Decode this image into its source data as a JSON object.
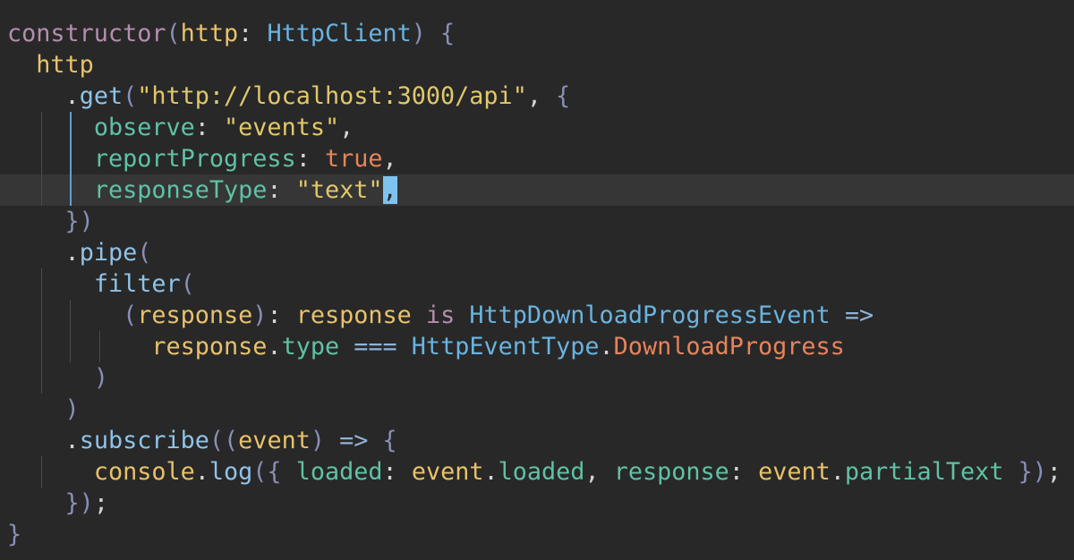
{
  "editor": {
    "theme": {
      "background": "#282828",
      "active_line": "#363636",
      "cursor": "#7ec3f0"
    },
    "cursor": {
      "line": 6,
      "token": ","
    },
    "lines": [
      {
        "tokens": [
          {
            "t": "constructor",
            "c": "kw"
          },
          {
            "t": "(",
            "c": "br"
          },
          {
            "t": "http",
            "c": "pm"
          },
          {
            "t": ": ",
            "c": "pu"
          },
          {
            "t": "HttpClient",
            "c": "ty"
          },
          {
            "t": ") {",
            "c": "br"
          }
        ]
      },
      {
        "tokens": [
          {
            "t": "  ",
            "c": "pu"
          },
          {
            "t": "http",
            "c": "id"
          }
        ]
      },
      {
        "tokens": [
          {
            "t": "    ",
            "c": "pu"
          },
          {
            "t": ".",
            "c": "pu"
          },
          {
            "t": "get",
            "c": "fn"
          },
          {
            "t": "(",
            "c": "br"
          },
          {
            "t": "\"http://localhost:3000/api\"",
            "c": "st"
          },
          {
            "t": ", ",
            "c": "pu"
          },
          {
            "t": "{",
            "c": "br"
          }
        ]
      },
      {
        "tokens": [
          {
            "t": "      ",
            "c": "pu"
          },
          {
            "t": "observe",
            "c": "pr"
          },
          {
            "t": ": ",
            "c": "pu"
          },
          {
            "t": "\"events\"",
            "c": "st"
          },
          {
            "t": ",",
            "c": "pu"
          }
        ]
      },
      {
        "tokens": [
          {
            "t": "      ",
            "c": "pu"
          },
          {
            "t": "reportProgress",
            "c": "pr"
          },
          {
            "t": ": ",
            "c": "pu"
          },
          {
            "t": "true",
            "c": "bo"
          },
          {
            "t": ",",
            "c": "pu"
          }
        ]
      },
      {
        "tokens": [
          {
            "t": "      ",
            "c": "pu"
          },
          {
            "t": "responseType",
            "c": "pr"
          },
          {
            "t": ": ",
            "c": "pu"
          },
          {
            "t": "\"text\"",
            "c": "st"
          },
          {
            "t": ",",
            "c": "cursor"
          }
        ]
      },
      {
        "tokens": [
          {
            "t": "    ",
            "c": "pu"
          },
          {
            "t": "})",
            "c": "br"
          }
        ]
      },
      {
        "tokens": [
          {
            "t": "    ",
            "c": "pu"
          },
          {
            "t": ".",
            "c": "pu"
          },
          {
            "t": "pipe",
            "c": "fn"
          },
          {
            "t": "(",
            "c": "br"
          }
        ]
      },
      {
        "tokens": [
          {
            "t": "      ",
            "c": "pu"
          },
          {
            "t": "filter",
            "c": "fn"
          },
          {
            "t": "(",
            "c": "br"
          }
        ]
      },
      {
        "tokens": [
          {
            "t": "        ",
            "c": "pu"
          },
          {
            "t": "(",
            "c": "br"
          },
          {
            "t": "response",
            "c": "pm"
          },
          {
            "t": ")",
            "c": "br"
          },
          {
            "t": ": ",
            "c": "pu"
          },
          {
            "t": "response",
            "c": "pm"
          },
          {
            "t": " ",
            "c": "pu"
          },
          {
            "t": "is",
            "c": "kw"
          },
          {
            "t": " ",
            "c": "pu"
          },
          {
            "t": "HttpDownloadProgressEvent",
            "c": "ty"
          },
          {
            "t": " ",
            "c": "pu"
          },
          {
            "t": "=>",
            "c": "op"
          }
        ]
      },
      {
        "tokens": [
          {
            "t": "          ",
            "c": "pu"
          },
          {
            "t": "response",
            "c": "pm"
          },
          {
            "t": ".",
            "c": "pu"
          },
          {
            "t": "type",
            "c": "pr"
          },
          {
            "t": " ",
            "c": "pu"
          },
          {
            "t": "===",
            "c": "op"
          },
          {
            "t": " ",
            "c": "pu"
          },
          {
            "t": "HttpEventType",
            "c": "ty"
          },
          {
            "t": ".",
            "c": "pu"
          },
          {
            "t": "DownloadProgress",
            "c": "bo"
          }
        ]
      },
      {
        "tokens": [
          {
            "t": "      ",
            "c": "pu"
          },
          {
            "t": ")",
            "c": "br"
          }
        ]
      },
      {
        "tokens": [
          {
            "t": "    ",
            "c": "pu"
          },
          {
            "t": ")",
            "c": "br"
          }
        ]
      },
      {
        "tokens": [
          {
            "t": "    ",
            "c": "pu"
          },
          {
            "t": ".",
            "c": "pu"
          },
          {
            "t": "subscribe",
            "c": "fn"
          },
          {
            "t": "((",
            "c": "br"
          },
          {
            "t": "event",
            "c": "pm"
          },
          {
            "t": ")",
            "c": "br"
          },
          {
            "t": " ",
            "c": "pu"
          },
          {
            "t": "=>",
            "c": "op"
          },
          {
            "t": " ",
            "c": "pu"
          },
          {
            "t": "{",
            "c": "br"
          }
        ]
      },
      {
        "tokens": [
          {
            "t": "      ",
            "c": "pu"
          },
          {
            "t": "console",
            "c": "id"
          },
          {
            "t": ".",
            "c": "pu"
          },
          {
            "t": "log",
            "c": "fn"
          },
          {
            "t": "({",
            "c": "br"
          },
          {
            "t": " ",
            "c": "pu"
          },
          {
            "t": "loaded",
            "c": "pr"
          },
          {
            "t": ": ",
            "c": "pu"
          },
          {
            "t": "event",
            "c": "pm"
          },
          {
            "t": ".",
            "c": "pu"
          },
          {
            "t": "loaded",
            "c": "pr"
          },
          {
            "t": ", ",
            "c": "pu"
          },
          {
            "t": "response",
            "c": "pr"
          },
          {
            "t": ": ",
            "c": "pu"
          },
          {
            "t": "event",
            "c": "pm"
          },
          {
            "t": ".",
            "c": "pu"
          },
          {
            "t": "partialText",
            "c": "pr"
          },
          {
            "t": " ",
            "c": "pu"
          },
          {
            "t": "})",
            "c": "br"
          },
          {
            "t": ";",
            "c": "pu"
          }
        ]
      },
      {
        "tokens": [
          {
            "t": "    ",
            "c": "pu"
          },
          {
            "t": "})",
            "c": "br"
          },
          {
            "t": ";",
            "c": "pu"
          }
        ]
      },
      {
        "tokens": [
          {
            "t": "}",
            "c": "br"
          }
        ]
      }
    ]
  }
}
